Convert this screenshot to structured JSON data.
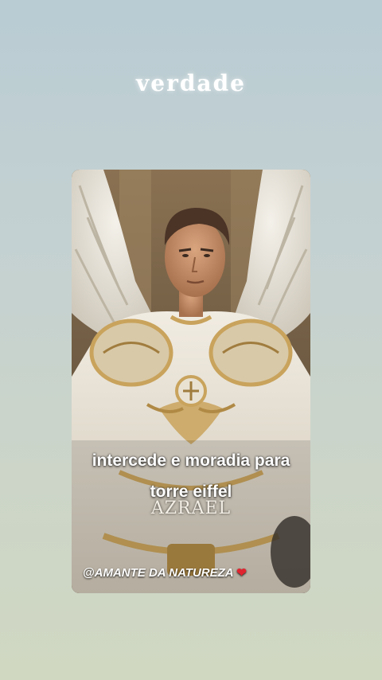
{
  "header": {
    "title": "verdade"
  },
  "card": {
    "caption_line1": "intercede e moradia para",
    "caption_line2": "torre eiffel",
    "name": "AZRAEL",
    "handle": "@AMANTE DA NATUREZA",
    "heart_icon": "❤"
  },
  "colors": {
    "background_top": "#b9ccd3",
    "background_bottom": "#d0d8c2",
    "gold": "#c9a35c",
    "heart": "#e0242f"
  }
}
